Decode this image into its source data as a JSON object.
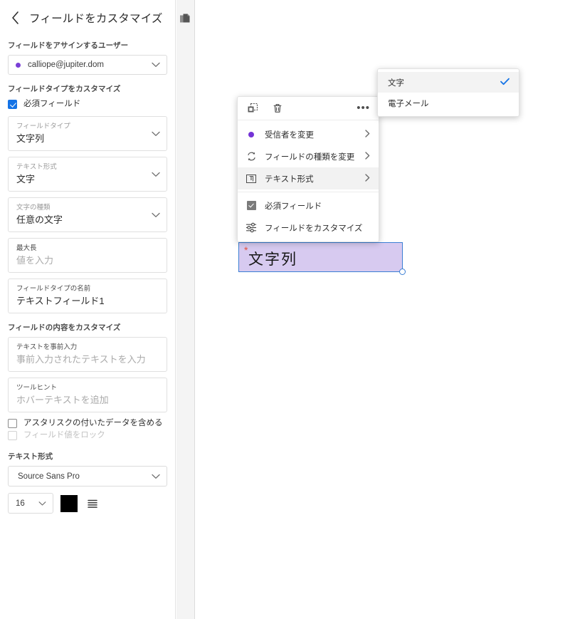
{
  "panel": {
    "back_icon": "chevron-left-icon",
    "title": "フィールドをカスタマイズ",
    "sections": {
      "assign_user_label": "フィールドをアサインするユーザー",
      "customize_field_type_label": "フィールドタイプをカスタマイズ",
      "customize_field_content_label": "フィールドの内容をカスタマイズ",
      "text_format_label": "テキスト形式"
    },
    "recipient": {
      "value": "calliope@jupiter.dom",
      "dot_color": "#7a3fd6",
      "chevron_icon": "chevron-down-icon"
    },
    "required_checkbox": {
      "label": "必須フィールド",
      "checked": true
    },
    "fields": [
      {
        "label": "フィールドタイプ",
        "value": "文字列",
        "type": "select",
        "placeholder": false
      },
      {
        "label": "テキスト形式",
        "value": "文字",
        "type": "select",
        "placeholder": false
      },
      {
        "label": "文字の種類",
        "value": "任意の文字",
        "type": "select",
        "placeholder": false
      },
      {
        "label": "最大長",
        "value": "値を入力",
        "type": "input",
        "placeholder": true
      },
      {
        "label": "フィールドタイプの名前",
        "value": "テキストフィールド1",
        "type": "input",
        "placeholder": false
      }
    ],
    "content_fields": [
      {
        "label": "テキストを事前入力",
        "value": "事前入力されたテキストを入力",
        "type": "input",
        "placeholder": true
      },
      {
        "label": "ツールヒント",
        "value": "ホバーテキストを追加",
        "type": "input",
        "placeholder": true
      }
    ],
    "option_checkboxes": [
      {
        "label": "アスタリスクの付いたデータを含める",
        "checked": false,
        "disabled": false
      },
      {
        "label": "フィールド値をロック",
        "checked": false,
        "disabled": true
      }
    ],
    "font": {
      "family": "Source Sans Pro",
      "size": "16",
      "color": "#000000",
      "align_icon": "align-justify-icon",
      "family_chevron_icon": "chevron-down-icon",
      "size_chevron_icon": "chevron-down-icon"
    }
  },
  "rail": {
    "pages_icon": "pages-icon"
  },
  "context_menu": {
    "toolbar": {
      "duplicate_icon": "duplicate-icon",
      "delete_icon": "trash-icon",
      "more_icon": "more-options-icon",
      "more_label": "•••"
    },
    "items": [
      {
        "icon": "recipient-dot-icon",
        "label": "受信者を変更",
        "arrow": "chevron-right-icon",
        "highlighted": false
      },
      {
        "icon": "change-field-type-icon",
        "label": "フィールドの種類を変更",
        "arrow": "chevron-right-icon",
        "highlighted": false
      },
      {
        "icon": "text-format-icon",
        "label": "テキスト形式",
        "arrow": "chevron-right-icon",
        "highlighted": true
      },
      {
        "icon": "checkbox-checked-icon",
        "label": "必須フィールド",
        "arrow": "",
        "highlighted": false
      },
      {
        "icon": "sliders-icon",
        "label": "フィールドをカスタマイズ",
        "arrow": "",
        "highlighted": false
      }
    ]
  },
  "submenu": {
    "items": [
      {
        "label": "文字",
        "selected": true,
        "check_icon": "check-icon"
      },
      {
        "label": "電子メール",
        "selected": false,
        "check_icon": ""
      }
    ],
    "check_color": "#1473e6"
  },
  "canvas_field": {
    "text": "文字列",
    "required_marker": "*",
    "fill_color": "#d7caf0",
    "border_color": "#3b7fd4",
    "marker_color": "#e8503a"
  }
}
